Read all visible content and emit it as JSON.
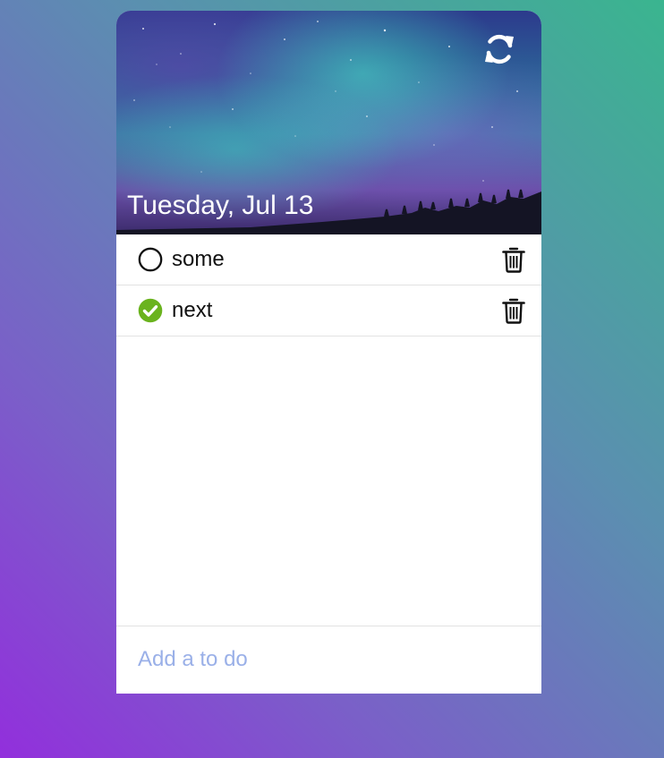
{
  "header": {
    "date": "Tuesday, Jul 13",
    "refresh_icon": "refresh-icon"
  },
  "todos": [
    {
      "text": "some",
      "done": false
    },
    {
      "text": "next",
      "done": true
    }
  ],
  "add": {
    "placeholder": "Add a to do"
  },
  "colors": {
    "done_check": "#6ab31e",
    "placeholder": "#9ab0e8"
  }
}
